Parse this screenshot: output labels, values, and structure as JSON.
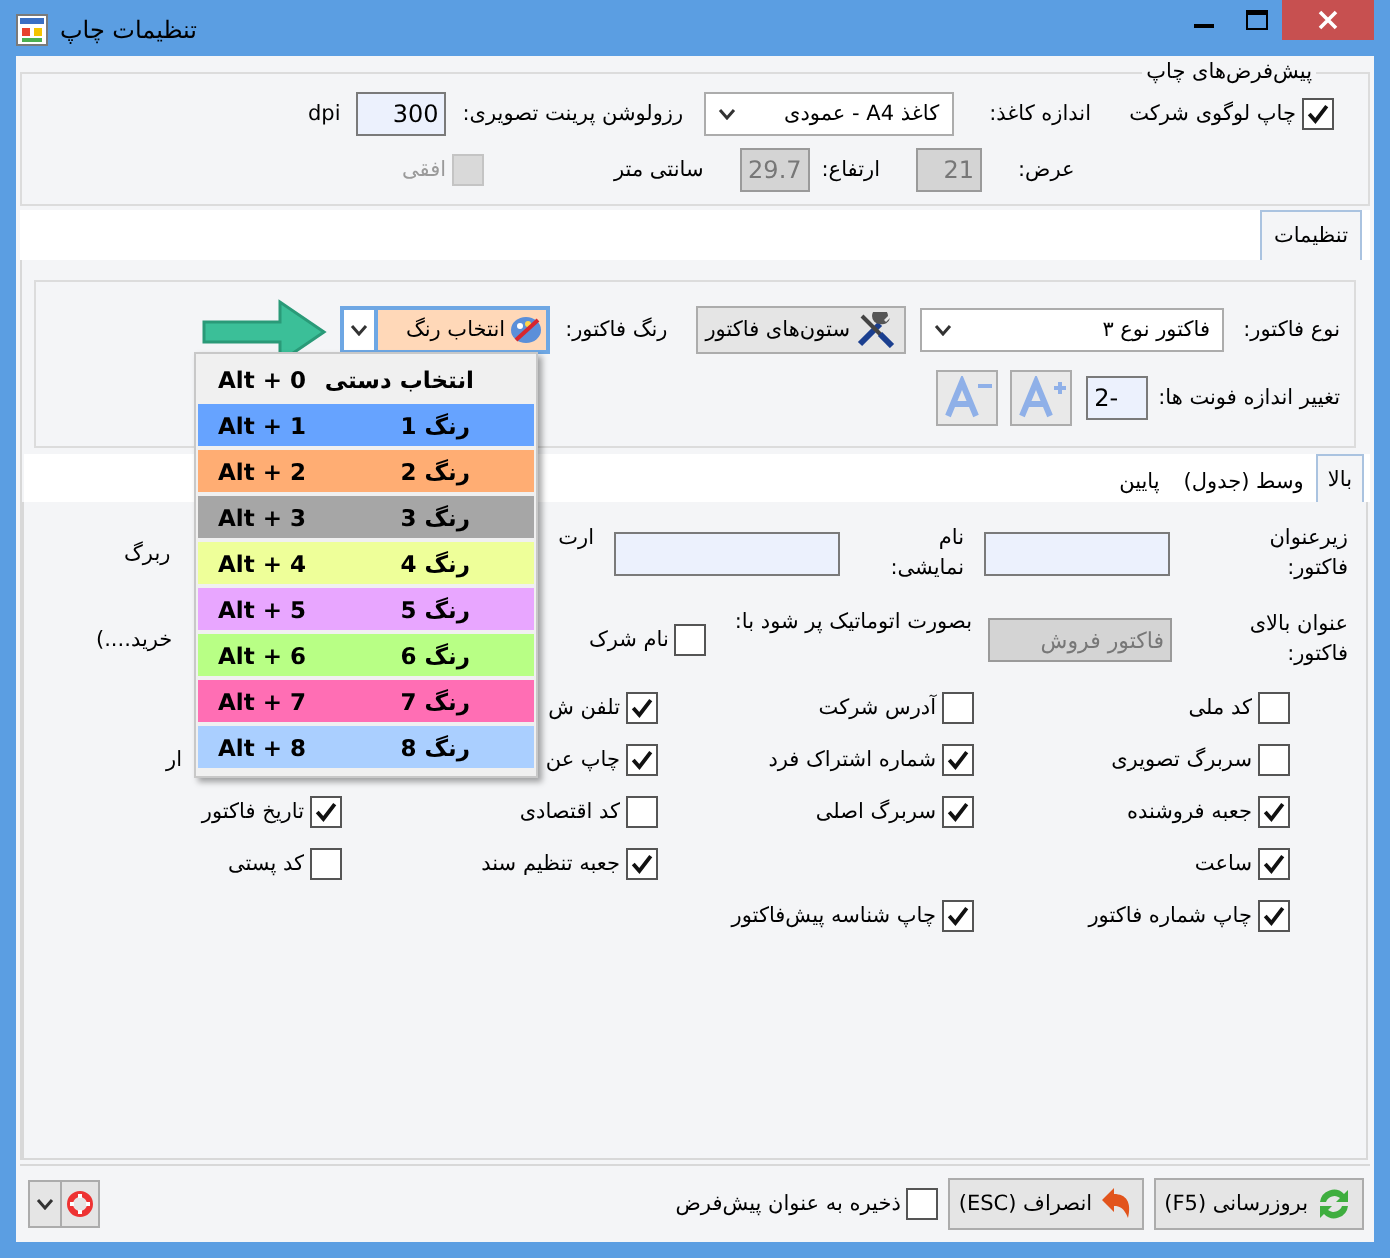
{
  "window": {
    "title": "تنظیمات چاپ"
  },
  "defaults_group": {
    "title": "پیش‌فرض‌های چاپ",
    "print_logo": {
      "label": "چاپ لوگوی شرکت",
      "checked": true
    },
    "paper_size": {
      "label": "اندازه کاغذ:",
      "value": "کاغذ A4 - عمودی"
    },
    "resolution": {
      "label": "رزولوشن پرینت تصویری:",
      "value": "300",
      "unit": "dpi"
    },
    "width": {
      "label": "عرض:",
      "value": "21",
      "disabled": true
    },
    "height": {
      "label": "ارتفاع:",
      "value": "29.7",
      "disabled": true
    },
    "unit": "سانتی متر",
    "landscape": {
      "label": "افقی",
      "checked": false,
      "disabled": true
    }
  },
  "tabs": [
    {
      "label": "تنظیمات",
      "selected": true
    }
  ],
  "invoice_group": {
    "type": {
      "label": "نوع فاکتور:",
      "value": "فاکتور نوع ۳"
    },
    "columns_button": "ستون‌های فاکتور",
    "color": {
      "label": "رنگ فاکتور:",
      "value": "انتخاب رنگ"
    },
    "font_size": {
      "label": "تغییر اندازه فونت ها:",
      "value": "-2"
    }
  },
  "inner_tabs": [
    {
      "label": "بالا",
      "selected": true
    },
    {
      "label": "وسط (جدول)",
      "selected": false
    },
    {
      "label": "پایین",
      "selected": false
    }
  ],
  "header_fields": {
    "subtitle": {
      "label": "زیرعنوان فاکتور:"
    },
    "display_name": {
      "label": "نام نمایشی:"
    },
    "column_3_label": "ارت",
    "column_4_label": "ربرگ",
    "title_above": {
      "label": "عنوان بالای فاکتور:",
      "value": "فاکتور فروش",
      "disabled": true
    },
    "auto_fill": {
      "label": "بصورت اتوماتیک پر شود با:"
    },
    "company_name": {
      "label": "نام شرک",
      "checked": false
    },
    "column_4_text": "خرید....)"
  },
  "option_rows": [
    {
      "items": [
        {
          "kind": "checkbox",
          "label": "کد ملی",
          "checked": false
        },
        {
          "kind": "checkbox",
          "label": "آدرس شرکت",
          "checked": false
        },
        {
          "kind": "checkbox",
          "label": "تلفن ش",
          "checked": true
        }
      ]
    },
    {
      "items": [
        {
          "kind": "checkbox",
          "label": "سربرگ تصویری",
          "checked": false
        },
        {
          "kind": "checkbox",
          "label": "شماره اشتراک فرد",
          "checked": true
        },
        {
          "kind": "checkbox",
          "label": "چاپ عن",
          "checked": true
        },
        {
          "kind": "text",
          "label": "ار"
        }
      ]
    },
    {
      "items": [
        {
          "kind": "checkbox",
          "label": "جعبه فروشنده",
          "checked": true
        },
        {
          "kind": "checkbox",
          "label": "سربرگ اصلی",
          "checked": true
        },
        {
          "kind": "checkbox",
          "label": "کد اقتصادی",
          "checked": false
        },
        {
          "kind": "checkbox",
          "label": "تاریخ فاکتور",
          "checked": true
        }
      ]
    },
    {
      "items": [
        {
          "kind": "checkbox",
          "label": "ساعت",
          "checked": true
        },
        {
          "kind": "gap"
        },
        {
          "kind": "checkbox",
          "label": "جعبه تنظیم سند",
          "checked": true
        },
        {
          "kind": "checkbox",
          "label": "کد پستی",
          "checked": false
        }
      ]
    },
    {
      "items": [
        {
          "kind": "checkbox",
          "label": "چاپ شماره فاکتور",
          "checked": true
        },
        {
          "kind": "checkbox",
          "label": "چاپ شناسه پیش‌فاکتور",
          "checked": true
        }
      ]
    }
  ],
  "color_menu": [
    {
      "kind": "manual",
      "label": "انتخاب دستی",
      "shortcut": "Alt + 0"
    },
    {
      "kind": "color",
      "label": "رنگ 1",
      "shortcut": "Alt + 1",
      "color": "#66a3ff"
    },
    {
      "kind": "color",
      "label": "رنگ 2",
      "shortcut": "Alt + 2",
      "color": "#ffad73"
    },
    {
      "kind": "color",
      "label": "رنگ 3",
      "shortcut": "Alt + 3",
      "color": "#a6a6a6"
    },
    {
      "kind": "color",
      "label": "رنگ 4",
      "shortcut": "Alt + 4",
      "color": "#eeff99"
    },
    {
      "kind": "color",
      "label": "رنگ 5",
      "shortcut": "Alt + 5",
      "color": "#e8a6ff"
    },
    {
      "kind": "color",
      "label": "رنگ 6",
      "shortcut": "Alt + 6",
      "color": "#b8ff85"
    },
    {
      "kind": "color",
      "label": "رنگ 7",
      "shortcut": "Alt + 7",
      "color": "#ff6eb4"
    },
    {
      "kind": "color",
      "label": "رنگ 8",
      "shortcut": "Alt + 8",
      "color": "#aacfff"
    }
  ],
  "footer": {
    "refresh_button": "بروزرسانی (F5)",
    "cancel_button": "انصراف (ESC)",
    "save_default": {
      "label": "ذخیره به عنوان پیش‌فرض",
      "checked": false
    }
  }
}
